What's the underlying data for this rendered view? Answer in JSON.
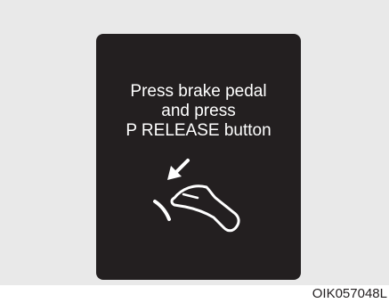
{
  "display": {
    "message_lines": [
      "Press brake pedal",
      "and press",
      "P RELEASE button"
    ],
    "icon": "brake-pedal-press-icon",
    "background_color": "#231f20",
    "text_color": "#ffffff"
  },
  "figure_code": "OIK057048L"
}
